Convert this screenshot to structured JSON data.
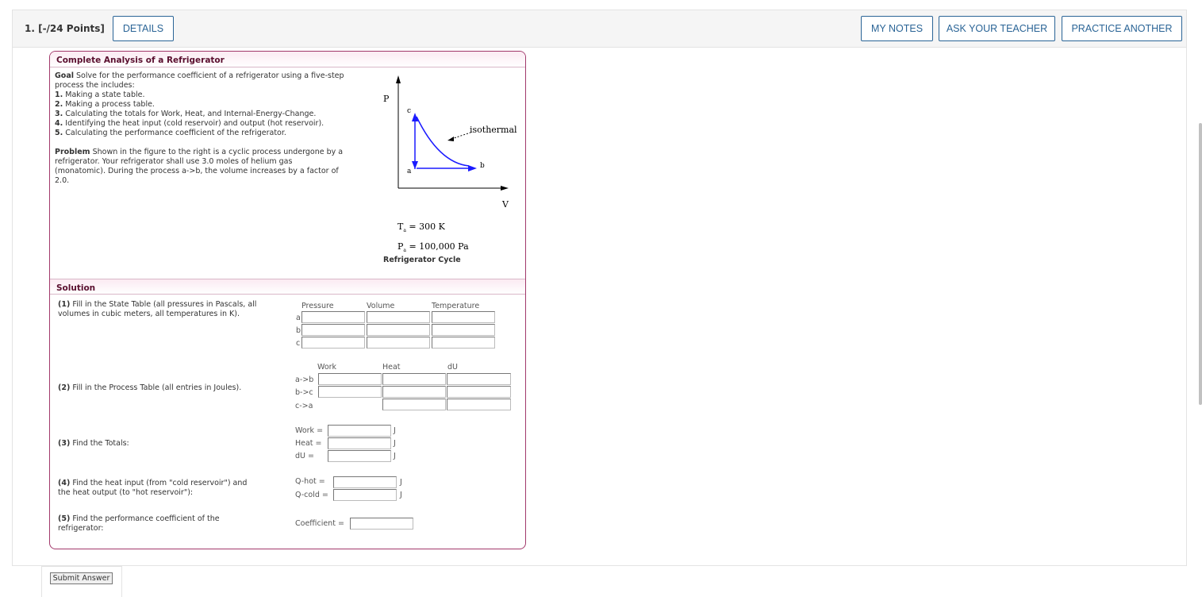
{
  "header": {
    "question_label": "1.  [-/24 Points]",
    "details": "DETAILS",
    "my_notes": "MY NOTES",
    "ask_teacher": "ASK YOUR TEACHER",
    "practice_another": "PRACTICE ANOTHER"
  },
  "analysis": {
    "title": "Complete Analysis of a Refrigerator",
    "goal_label": "Goal",
    "goal_text": "Solve for the performance coefficient of a refrigerator using a five-step",
    "goal_text2": "process the includes:",
    "steps": [
      {
        "num": "1.",
        "text": "Making a state table."
      },
      {
        "num": "2.",
        "text": "Making a process table."
      },
      {
        "num": "3.",
        "text": "Calculating the totals for Work, Heat, and Internal-Energy-Change."
      },
      {
        "num": "4.",
        "text": "Identifying the heat input (cold reservoir) and output (hot reservoir)."
      },
      {
        "num": "5.",
        "text": "Calculating the performance coefficient of the refrigerator."
      }
    ],
    "problem_label": "Problem",
    "problem_lines": [
      "Shown in the figure to the right is a cyclic process undergone by a",
      "refrigerator. Your refrigerator shall use 3.0 moles of helium gas",
      "(monatomic). During the process a->b, the volume increases by a factor of",
      "2.0."
    ]
  },
  "diagram": {
    "p_axis": "P",
    "v_axis": "V",
    "point_a": "a",
    "point_b": "b",
    "point_c": "c",
    "isothermal": "isothermal",
    "ta_label": "T",
    "ta_sub": "a",
    "ta_value": "= 300 K",
    "pa_label": "P",
    "pa_sub": "a",
    "pa_value": "= 100,000 Pa",
    "caption": "Refrigerator Cycle",
    "colors": {
      "path": "#1a1aff",
      "axis": "#000000"
    }
  },
  "solution": {
    "title": "Solution",
    "step1_label": "(1)",
    "step1_text": "Fill in the State Table (all pressures in Pascals, all",
    "step1_text2": "volumes in cubic meters, all temperatures in K).",
    "state_headers": [
      "Pressure",
      "Volume",
      "Temperature"
    ],
    "state_rows": [
      "a",
      "b",
      "c"
    ],
    "step2_label": "(2)",
    "step2_text": "Fill in the Process Table (all entries in Joules).",
    "process_headers": [
      "Work",
      "Heat",
      "dU"
    ],
    "process_rows": [
      "a->b",
      "b->c",
      "c->a"
    ],
    "step3_label": "(3)",
    "step3_text": "Find the Totals:",
    "totals": [
      {
        "label": "Work =",
        "unit": "J"
      },
      {
        "label": "Heat =",
        "unit": "J"
      },
      {
        "label": "dU =",
        "unit": "J"
      }
    ],
    "step4_label": "(4)",
    "step4_text": "Find the heat input (from \"cold reservoir\") and",
    "step4_text2": "the heat output (to \"hot reservoir\"):",
    "heats": [
      {
        "label": "Q-hot =",
        "unit": "J"
      },
      {
        "label": "Q-cold =",
        "unit": "J"
      }
    ],
    "step5_label": "(5)",
    "step5_text": "Find the performance coefficient of the",
    "step5_text2": "refrigerator:",
    "coefficient_label": "Coefficient ="
  },
  "submit": "Submit Answer"
}
